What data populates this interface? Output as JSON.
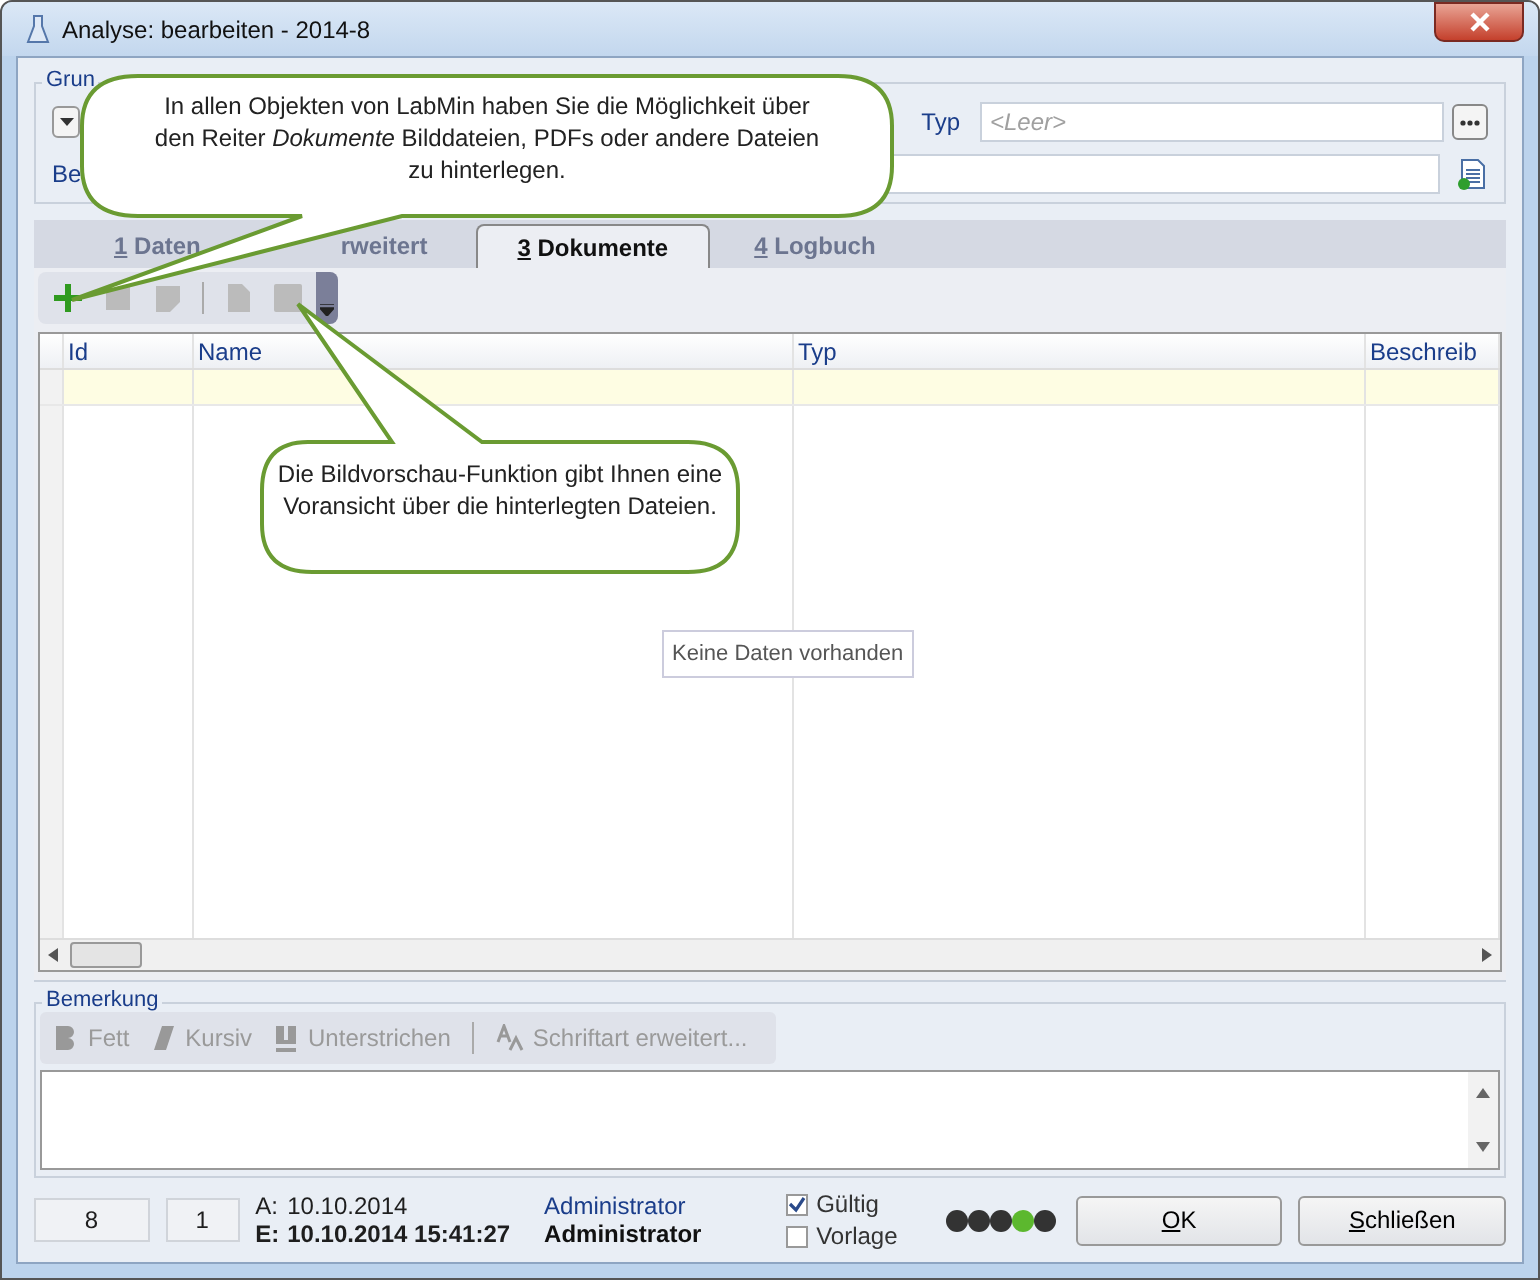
{
  "window": {
    "title": "Analyse: bearbeiten - 2014-8"
  },
  "header": {
    "group_label": "Grun",
    "type_label": "Typ",
    "type_placeholder": "<Leer>",
    "description_label": "Be"
  },
  "tabs": [
    {
      "label": "1 Daten",
      "mnemonic": true,
      "selected": false
    },
    {
      "label": "rweitert",
      "mnemonic": false,
      "selected": false
    },
    {
      "label": "3 Dokumente",
      "mnemonic": true,
      "selected": true
    },
    {
      "label": "4 Logbuch",
      "mnemonic": true,
      "selected": false
    }
  ],
  "grid": {
    "columns": [
      "Id",
      "Name",
      "Typ",
      "Beschreib"
    ],
    "empty_text": "Keine Daten vorhanden"
  },
  "remark": {
    "label": "Bemerkung",
    "tools": [
      {
        "kind": "bold",
        "label": "Fett",
        "disabled": true
      },
      {
        "kind": "italic",
        "label": "Kursiv",
        "disabled": true
      },
      {
        "kind": "underline",
        "label": "Unterstrichen",
        "disabled": true
      },
      {
        "kind": "font",
        "label": "Schriftart erweitert...",
        "disabled": true
      }
    ]
  },
  "status": {
    "count": "8",
    "version": "1",
    "created_label": "A:",
    "created": "10.10.2014",
    "edited_label": "E:",
    "edited": "10.10.2014 15:41:27",
    "created_by": "Administrator",
    "edited_by": "Administrator",
    "flags": [
      {
        "label": "Gültig",
        "checked": true
      },
      {
        "label": "Vorlage",
        "checked": false
      }
    ],
    "lights": [
      {
        "color": "#333333"
      },
      {
        "color": "#333333"
      },
      {
        "color": "#333333"
      },
      {
        "color": "#5cb82e"
      },
      {
        "color": "#333333"
      }
    ]
  },
  "buttons": [
    {
      "label": "OK",
      "mnemonic": true
    },
    {
      "label": "Schließen",
      "mnemonic": true
    }
  ],
  "callouts": [
    {
      "text": "In allen Objekten von LabMin haben Sie die Möglichkeit über den Reiter *Dokumente* Bilddateien, PDFs oder andere Dateien zu hinterlegen."
    },
    {
      "text": "Die Bildvorschau-Funktion gibt Ihnen eine Voransicht über die hinterlegten Dateien."
    }
  ]
}
